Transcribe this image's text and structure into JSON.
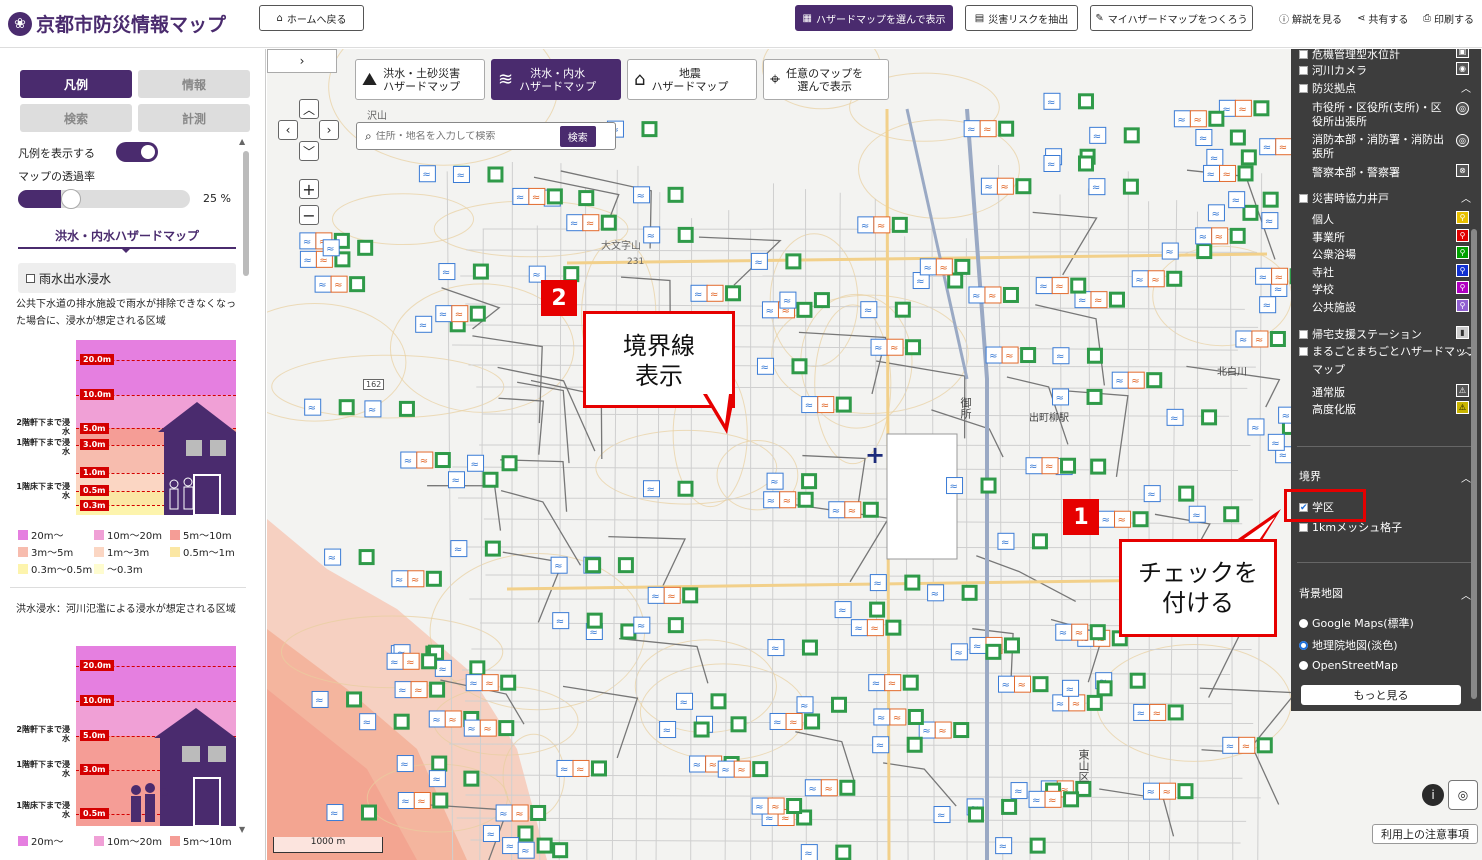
{
  "header": {
    "title": "京都市防災情報マップ",
    "home_button": "ホームへ戻る",
    "hazard_select_button": "ハザードマップを選んで表示",
    "extract_risk_button": "災害リスクを抽出",
    "my_hazard_button": "マイハザードマップをつくろう",
    "help_link": "解説を見る",
    "share_link": "共有する",
    "print_link": "印刷する"
  },
  "sidebar": {
    "tabs": {
      "legend": "凡例",
      "info": "情報",
      "search": "検索",
      "measure": "計測"
    },
    "show_legend_label": "凡例を表示する",
    "opacity_label": "マップの透過率",
    "opacity_value": 25,
    "opacity_text": "25 %",
    "section_title": "洪水・内水ハザードマップ",
    "rain_checkbox": "雨水出水浸水",
    "rain_desc": "公共下水道の排水施設で雨水が排除できなくなった場合に、浸水が想定される区域",
    "depths1": [
      "20.0m",
      "10.0m",
      "5.0m",
      "3.0m",
      "1.0m",
      "0.5m",
      "0.3m"
    ],
    "floor_labels": [
      "2階軒下まで浸水",
      "1階軒下まで浸水",
      "1階床下まで浸水"
    ],
    "swatches": [
      {
        "label": "20m～",
        "color": "#e57fe0"
      },
      {
        "label": "10m～20m",
        "color": "#f0a0d6"
      },
      {
        "label": "5m～10m",
        "color": "#f59d96"
      },
      {
        "label": "3m～5m",
        "color": "#f7bcae"
      },
      {
        "label": "1m～3m",
        "color": "#fbd6c3"
      },
      {
        "label": "0.5m～1m",
        "color": "#fbe7a4"
      },
      {
        "label": "0.3m～0.5m",
        "color": "#fdf4ad"
      },
      {
        "label": "～0.3m",
        "color": "#fefccf"
      }
    ],
    "flood_desc": "洪水浸水：河川氾濫による浸水が想定される区域",
    "depths2": [
      "20.0m",
      "10.0m",
      "5.0m",
      "3.0m",
      "0.5m"
    ],
    "swatches2": [
      "20m～",
      "10m～20m",
      "5m～10m"
    ]
  },
  "map": {
    "tabs": [
      {
        "label": "洪水・土砂災害\nハザードマップ"
      },
      {
        "label": "洪水・内水\nハザードマップ"
      },
      {
        "label": "地震\nハザードマップ"
      },
      {
        "label": "任意のマップを\n選んで表示"
      }
    ],
    "search_placeholder": "住所・地名を入力して検索",
    "search_button": "検索",
    "scale_label": "1000 m",
    "notice_button": "利用上の注意事項",
    "labels": {
      "river": "沢山",
      "daimonji": "大文字山",
      "elev": "231",
      "goshol": "御所",
      "kitashirakawa": "北白川",
      "demachi": "出町柳駅",
      "higashiyama": "東山区",
      "route": "162"
    }
  },
  "panel": {
    "items_top": [
      {
        "label": "危機管理型水位計"
      },
      {
        "label": "河川カメラ"
      },
      {
        "label": "防災拠点"
      }
    ],
    "facilities": [
      "市役所・区役所(支所)・区役所出張所",
      "消防本部・消防署・消防出張所",
      "警察本部・警察署"
    ],
    "wells_label": "災害時協力井戸",
    "wells": [
      "個人",
      "事業所",
      "公衆浴場",
      "寺社",
      "学校",
      "公共施設"
    ],
    "well_colors": [
      "#e8c000",
      "#e00000",
      "#00a000",
      "#1030d0",
      "#b000c0",
      "#9060d0"
    ],
    "station_label": "帰宅支援ステーション",
    "machigoto_label": "まるごとまちごとハザードマップ",
    "machigoto_items": [
      "通常版",
      "高度化版"
    ],
    "boundary_title": "境界",
    "school_label": "学区",
    "mesh_label": "1kmメッシュ格子",
    "base_title": "背景地図",
    "base_options": [
      "Google Maps(標準)",
      "地理院地図(淡色)",
      "OpenStreetMap"
    ],
    "more_button": "もっと見る"
  },
  "annotations": {
    "badge1": "1",
    "badge2": "2",
    "callout_check": "チェックを\n付ける",
    "callout_boundary": "境界線\n表示"
  }
}
